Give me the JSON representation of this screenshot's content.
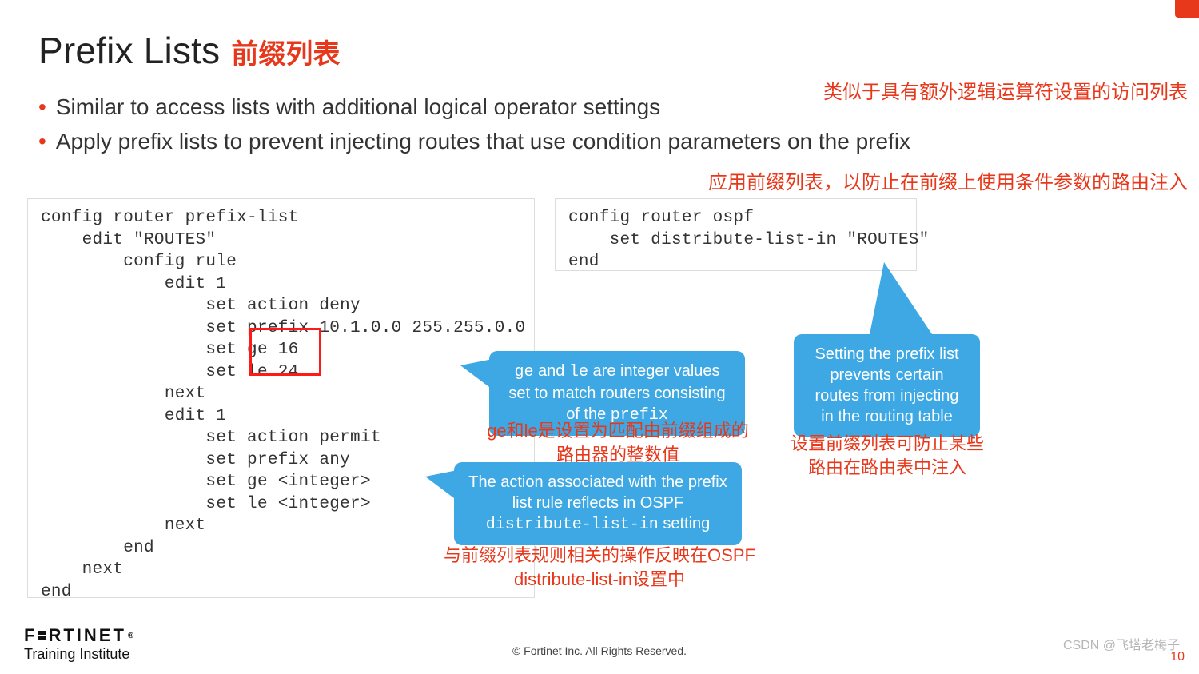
{
  "title": "Prefix Lists",
  "title_zh": "前缀列表",
  "bullets": [
    "Similar to access lists with additional logical operator settings",
    "Apply prefix lists to prevent injecting routes that use condition parameters on the prefix"
  ],
  "annot_right_1": "类似于具有额外逻辑运算符设置的访问列表",
  "annot_right_2": "应用前缀列表，以防止在前缀上使用条件参数的路由注入",
  "code_left": "config router prefix-list\n    edit \"ROUTES\"\n        config rule\n            edit 1\n                set action deny\n                set prefix 10.1.0.0 255.255.0.0\n                set ge 16\n                set le 24\n            next\n            edit 1\n                set action permit\n                set prefix any\n                set ge <integer>\n                set le <integer>\n            next\n        end\n    next\nend",
  "code_right": "config router ospf\n    set distribute-list-in \"ROUTES\"\nend",
  "callouts": {
    "c1_pre": "ge",
    "c1_mid": " and ",
    "c1_mid2": "le",
    "c1_tail": " are integer values set to match routers consisting of the ",
    "c1_prefix": "prefix",
    "c2_pre": "The action associated with the prefix list rule reflects in OSPF ",
    "c2_mono": "distribute-list-in",
    "c2_tail": " setting",
    "c3": "Setting the prefix list prevents certain routes from injecting in the routing table"
  },
  "red_notes": {
    "n1": "ge和le是设置为匹配由前缀组成的\n路由器的整数值",
    "n2": "与前缀列表规则相关的操作反映在OSPF\ndistribute-list-in设置中",
    "n3": "设置前缀列表可防止某些\n路由在路由表中注入"
  },
  "footer": {
    "copyright": "© Fortinet Inc. All Rights Reserved.",
    "page": "10",
    "watermark": "CSDN @飞塔老梅子",
    "brand_main": "F   RTINET",
    "brand_sub": "Training Institute"
  }
}
